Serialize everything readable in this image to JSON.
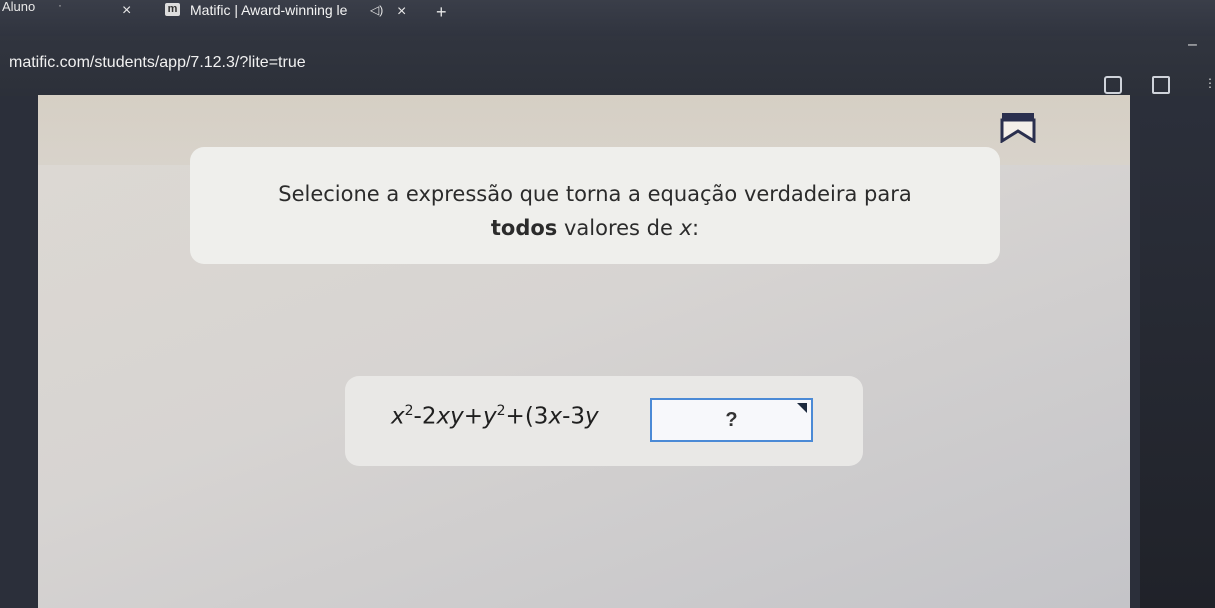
{
  "browser": {
    "profile": "Aluno",
    "tab_title": "Matific | Award-winning le",
    "tab_logo": "m",
    "new_tab": "+",
    "close": "×",
    "url": "matific.com/students/app/7.12.3/?lite=true"
  },
  "question": {
    "line1": "Selecione a expressão que torna a equação verdadeira para",
    "bold_word": "todos",
    "line2_rest": " valores de ",
    "variable": "x",
    "colon": ":"
  },
  "equation": {
    "parts": [
      "x",
      "2",
      "-2",
      "xy",
      "+",
      "y",
      "2",
      "+(3",
      "x",
      "-3",
      "y",
      ")="
    ],
    "answer_placeholder": "?"
  },
  "icons": {
    "bookmark": "bookmark-icon",
    "dropdown": "dropdown-triangle-icon"
  }
}
